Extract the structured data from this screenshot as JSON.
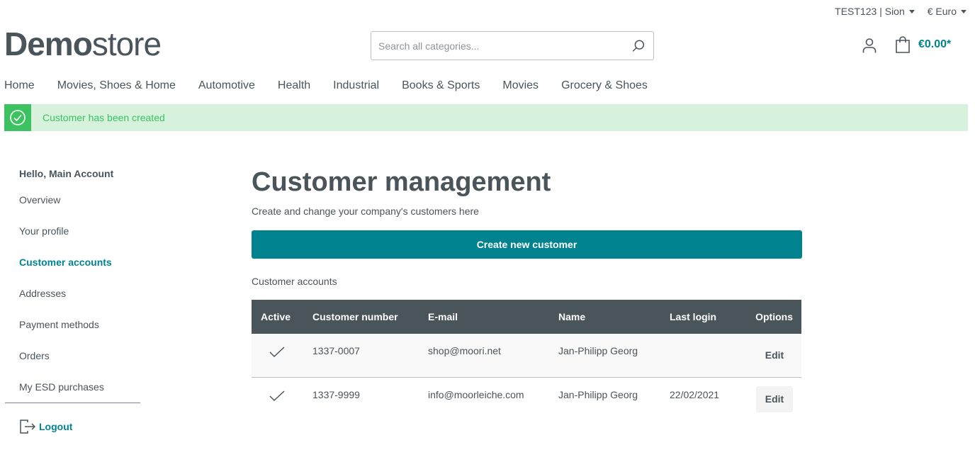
{
  "topbar": {
    "store_selector": "TEST123 | Sion",
    "currency_selector": "€ Euro"
  },
  "logo": {
    "bold": "Demo",
    "light": "store"
  },
  "search": {
    "placeholder": "Search all categories..."
  },
  "cart": {
    "total": "€0.00*"
  },
  "nav": {
    "items": [
      "Home",
      "Movies, Shoes & Home",
      "Automotive",
      "Health",
      "Industrial",
      "Books & Sports",
      "Movies",
      "Grocery & Shoes"
    ]
  },
  "alert": {
    "message": "Customer has been created"
  },
  "sidebar": {
    "greeting": "Hello, Main Account",
    "items": [
      {
        "label": "Overview"
      },
      {
        "label": "Your profile"
      },
      {
        "label": "Customer accounts"
      },
      {
        "label": "Addresses"
      },
      {
        "label": "Payment methods"
      },
      {
        "label": "Orders"
      },
      {
        "label": "My ESD purchases"
      }
    ],
    "logout": "Logout"
  },
  "main": {
    "title": "Customer management",
    "subtitle": "Create and change your company's customers here",
    "create_button": "Create new customer",
    "section_label": "Customer accounts",
    "table": {
      "headers": [
        "Active",
        "Customer number",
        "E-mail",
        "Name",
        "Last login",
        "Options"
      ],
      "rows": [
        {
          "number": "1337-0007",
          "email": "shop@moori.net",
          "name": "Jan-Philipp Georg",
          "last_login": "",
          "edit": "Edit"
        },
        {
          "number": "1337-9999",
          "email": "info@moorleiche.com",
          "name": "Jan-Philipp Georg",
          "last_login": "22/02/2021",
          "edit": "Edit"
        }
      ]
    }
  },
  "colors": {
    "accent": "#00838f",
    "text": "#4a545b",
    "success": "#3cc261",
    "success_bg": "#d6f2dc",
    "table_header": "#4a545b"
  }
}
